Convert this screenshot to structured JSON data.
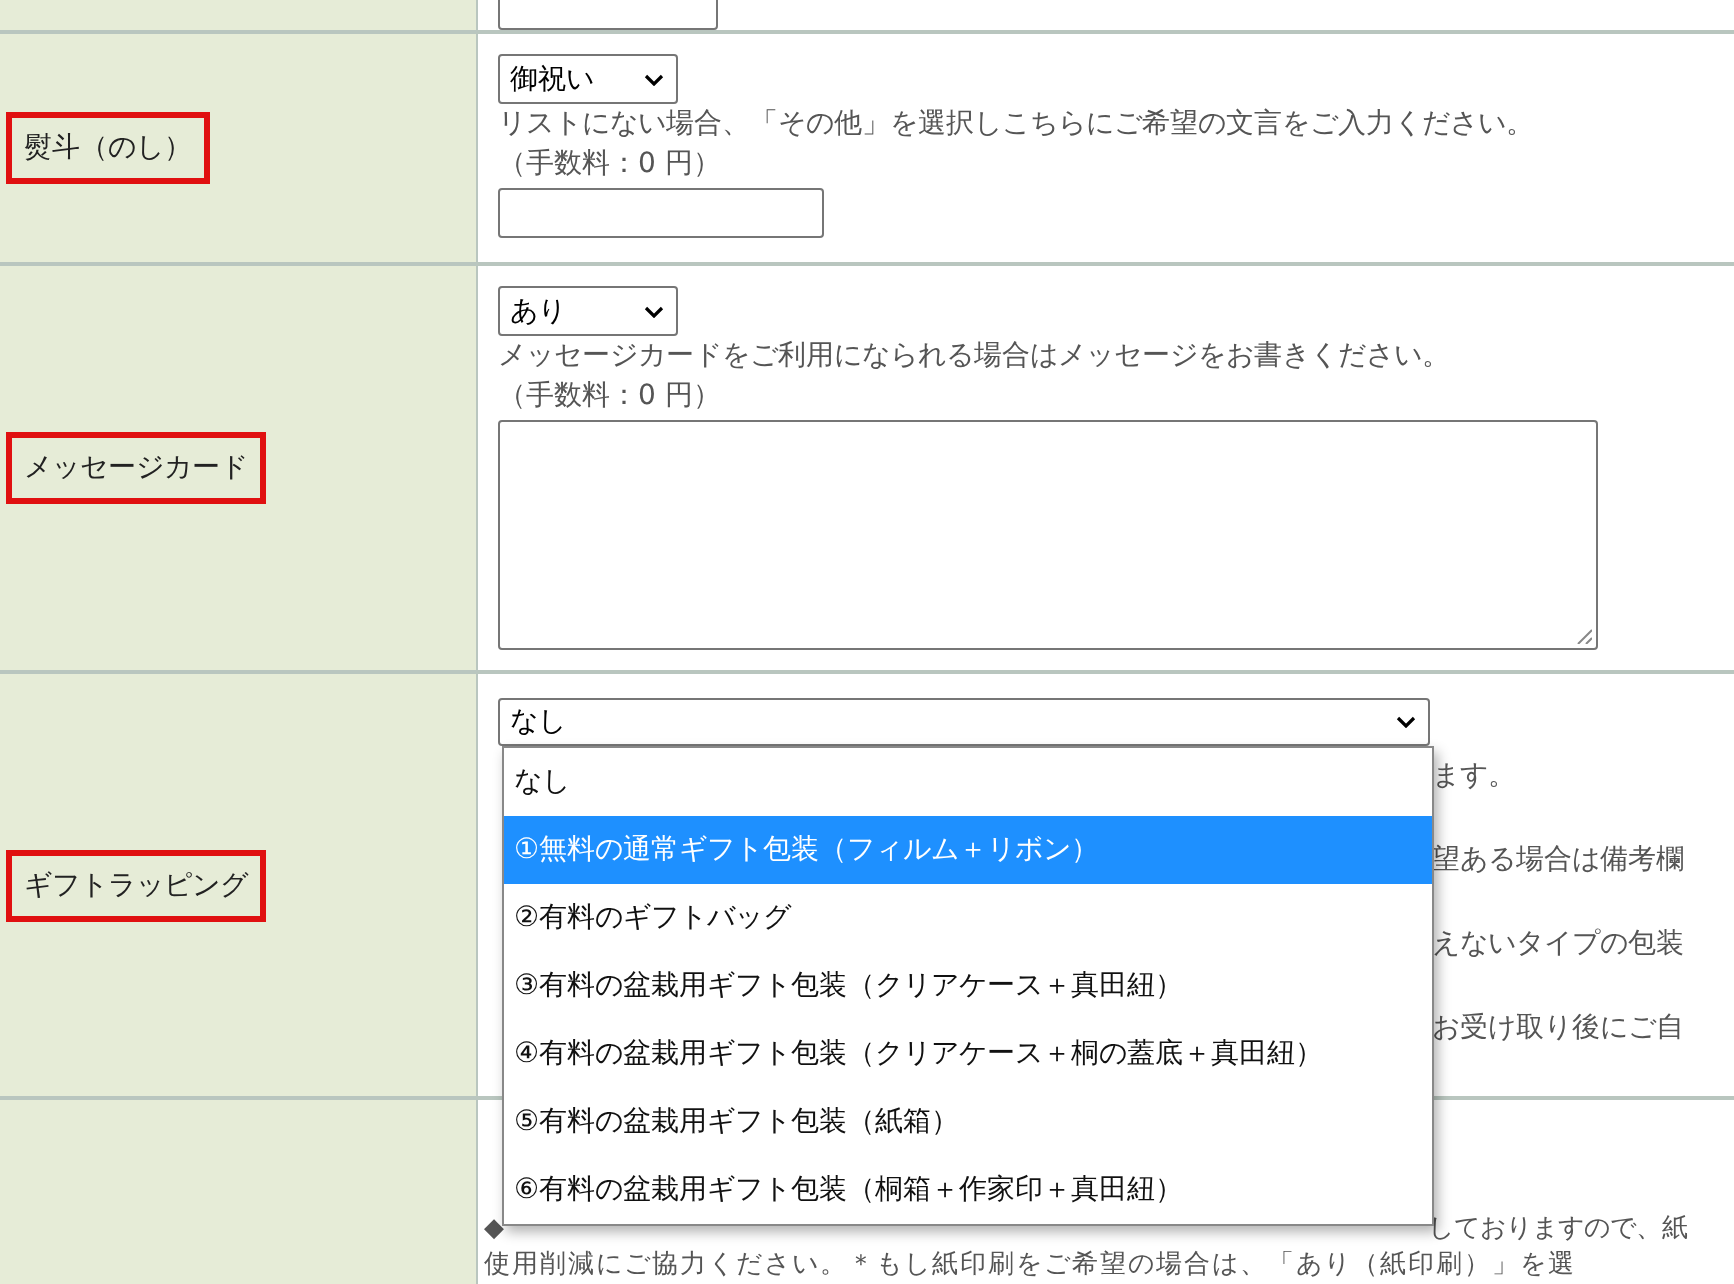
{
  "noshi": {
    "label": "熨斗（のし）",
    "select": "御祝い",
    "note": "リストにない場合、「その他」を選択しこちらにご希望の文言をご入力ください。",
    "fee": "（手数料：0 円）"
  },
  "message_card": {
    "label": "メッセージカード",
    "select": "あり",
    "note": "メッセージカードをご利用になられる場合はメッセージをお書きください。",
    "fee": "（手数料：0 円）"
  },
  "gift_wrapping": {
    "label": "ギフトラッピング",
    "select": "なし",
    "expanded": true,
    "options": [
      {
        "label": "なし",
        "selected": false
      },
      {
        "label": "①無料の通常ギフト包装（フィルム＋リボン）",
        "selected": true
      },
      {
        "label": "②有料のギフトバッグ",
        "selected": false
      },
      {
        "label": "③有料の盆栽用ギフト包装（クリアケース＋真田紐）",
        "selected": false
      },
      {
        "label": "④有料の盆栽用ギフト包装（クリアケース＋桐の蓋底＋真田紐）",
        "selected": false
      },
      {
        "label": "⑤有料の盆栽用ギフト包装（紙箱）",
        "selected": false
      },
      {
        "label": "⑥有料の盆栽用ギフト包装（桐箱＋作家印＋真田紐）",
        "selected": false
      }
    ],
    "note_fragments": [
      "ます。",
      "望ある場合は備考欄",
      "えないタイプの包装",
      "お受け取り後にご自"
    ]
  },
  "receipt": {
    "bullet": "◆",
    "line_end": "しておりますので、紙",
    "line_2": "使用削減にご協力ください。＊もし紙印刷をご希望の場合は、「あり（紙印刷）」を選"
  }
}
